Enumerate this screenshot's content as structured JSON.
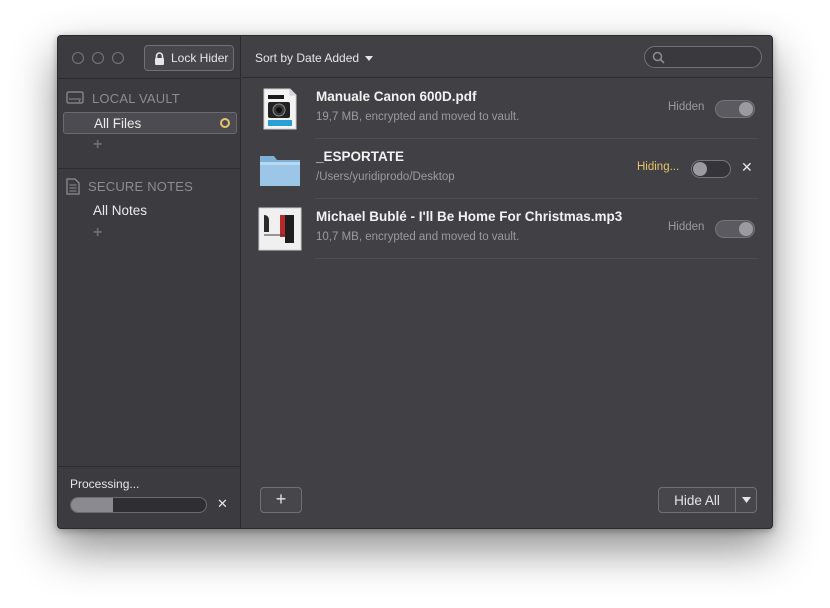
{
  "titlebar": {
    "lock_button_label": "Lock Hider"
  },
  "toolbar": {
    "sort_label": "Sort by Date Added",
    "search_placeholder": ""
  },
  "sidebar": {
    "local_vault": {
      "header": "LOCAL VAULT",
      "items": [
        {
          "label": "All Files",
          "selected": true
        }
      ]
    },
    "secure_notes": {
      "header": "SECURE NOTES",
      "items": [
        {
          "label": "All Notes",
          "selected": false
        }
      ]
    },
    "add_symbol": "+"
  },
  "processing": {
    "label": "Processing...",
    "progress": 0.31,
    "cancel_symbol": "✕"
  },
  "files": [
    {
      "name": "Manuale Canon 600D.pdf",
      "subtitle": "19,7 MB, encrypted and moved to vault.",
      "status": "Hidden",
      "icon": "pdf-document-icon",
      "toggle_on": true,
      "can_cancel": false
    },
    {
      "name": "_ESPORTATE",
      "subtitle": "/Users/yuridiprodo/Desktop",
      "status": "Hiding...",
      "icon": "folder-icon",
      "toggle_on": false,
      "can_cancel": true
    },
    {
      "name": "Michael Bublé - I'll Be Home For Christmas.mp3",
      "subtitle": "10,7 MB, encrypted and moved to vault.",
      "status": "Hidden",
      "icon": "album-art-icon",
      "toggle_on": true,
      "can_cancel": false
    }
  ],
  "footer": {
    "add_label": "+",
    "hide_all_label": "Hide All"
  },
  "colors": {
    "background": "#404045",
    "sidebar": "#3b3b40",
    "accent_hiding": "#e7c46a",
    "text": "#e6e6e6"
  }
}
